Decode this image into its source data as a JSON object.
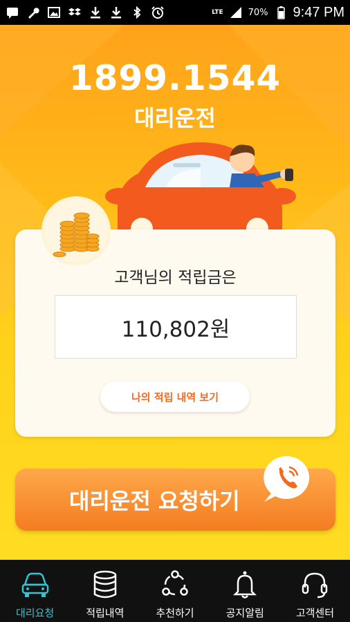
{
  "status_bar": {
    "left_icons": [
      "message-icon",
      "wrench-icon",
      "image-icon",
      "dropbox-icon",
      "download-icon",
      "download-icon",
      "bluetooth-icon",
      "alarm-icon"
    ],
    "network": "LTE",
    "battery": "70%",
    "time": "9:47 PM"
  },
  "header": {
    "phone_number": "1899.1544",
    "service_name": "대리운전"
  },
  "balance_card": {
    "title": "고객님의 적립금은",
    "amount": "110,802원",
    "history_button": "나의 적립 내역 보기"
  },
  "request_button": {
    "label": "대리운전 요청하기"
  },
  "bottom_nav": {
    "items": [
      {
        "label": "대리요청",
        "icon": "car-icon",
        "active": true
      },
      {
        "label": "적립내역",
        "icon": "coin-stack-icon",
        "active": false
      },
      {
        "label": "추천하기",
        "icon": "share-icon",
        "active": false
      },
      {
        "label": "공지알림",
        "icon": "bell-icon",
        "active": false
      },
      {
        "label": "고객센터",
        "icon": "headset-icon",
        "active": false
      }
    ]
  },
  "colors": {
    "background_top": "#ffa21a",
    "background_bottom": "#ffdc22",
    "accent_orange": "#f57c21",
    "active_nav": "#2ec5d6"
  }
}
